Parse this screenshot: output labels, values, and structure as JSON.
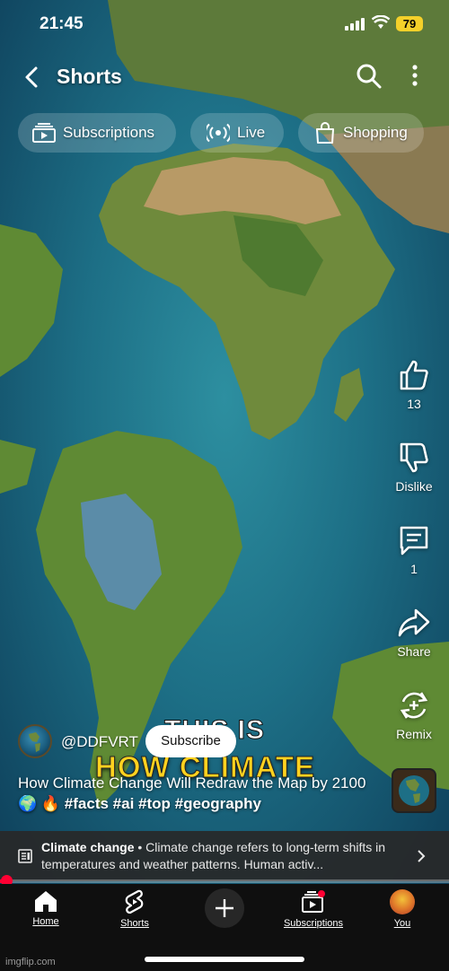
{
  "status_bar": {
    "time": "21:45",
    "battery": "79"
  },
  "header": {
    "title": "Shorts"
  },
  "chips": [
    {
      "label": "Subscriptions",
      "icon": "subscriptions-icon"
    },
    {
      "label": "Live",
      "icon": "live-icon"
    },
    {
      "label": "Shopping",
      "icon": "shopping-bag-icon"
    }
  ],
  "actions": {
    "like_count": "13",
    "dislike_label": "Dislike",
    "comments_count": "1",
    "share_label": "Share",
    "remix_label": "Remix"
  },
  "overlay_caption": {
    "line1": "THIS IS",
    "line2": "HOW CLIMATE"
  },
  "channel": {
    "handle": "@DDFVRT",
    "subscribe_label": "Subscribe"
  },
  "video": {
    "title": "How Climate Change Will Redraw the Map by 2100 🌍 🔥",
    "hashtags": "#facts #ai #top #geography"
  },
  "topic_banner": {
    "topic": "Climate change",
    "separator": " • ",
    "description": "Climate change refers to long-term shifts in temperatures and weather patterns. Human activ..."
  },
  "progress": {
    "fraction": 0.012
  },
  "bottom_nav": [
    {
      "label": "Home",
      "icon": "home-icon"
    },
    {
      "label": "Shorts",
      "icon": "shorts-icon"
    },
    {
      "label": "",
      "icon": "create-plus-icon"
    },
    {
      "label": "Subscriptions",
      "icon": "subscriptions-icon"
    },
    {
      "label": "You",
      "icon": "avatar"
    }
  ],
  "watermark": "imgflip.com",
  "colors": {
    "accent": "#ff0033",
    "caption_yellow": "#ffd21f",
    "battery": "#f4d02a"
  }
}
